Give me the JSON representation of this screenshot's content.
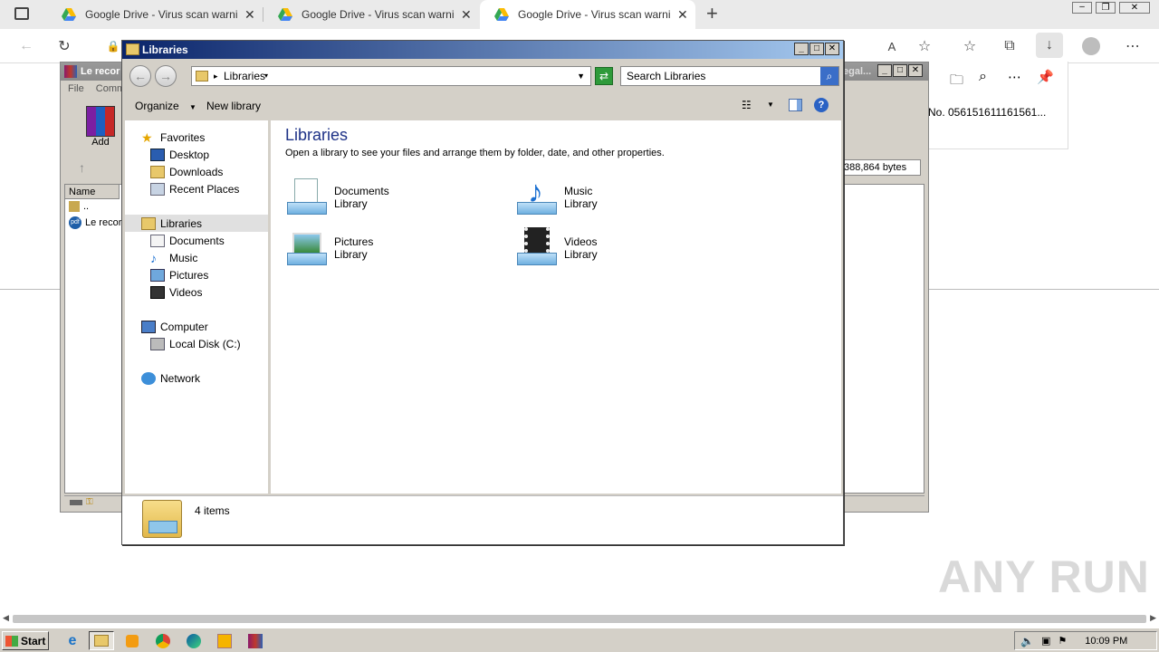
{
  "browser": {
    "tabs": [
      {
        "title": "Google Drive - Virus scan warning"
      },
      {
        "title": "Google Drive - Virus scan warning"
      },
      {
        "title": "Google Drive - Virus scan warning"
      }
    ],
    "new_tab": "+",
    "download_panel_text": "No. 056151611161561..."
  },
  "winrar": {
    "title": "Le recor",
    "title_right": "egal...",
    "menu": [
      "File",
      "Comm"
    ],
    "add_label": "Add",
    "column_name": "Name",
    "rows": [
      "..",
      "Le recor"
    ],
    "size_text": "388,864 bytes"
  },
  "explorer": {
    "title": "Libraries",
    "address": "Libraries",
    "search_placeholder": "Search Libraries",
    "organize": "Organize",
    "new_library": "New library",
    "nav": {
      "favorites": "Favorites",
      "desktop": "Desktop",
      "downloads": "Downloads",
      "recent": "Recent Places",
      "libraries": "Libraries",
      "documents": "Documents",
      "music": "Music",
      "pictures": "Pictures",
      "videos": "Videos",
      "computer": "Computer",
      "local_disk": "Local Disk (C:)",
      "network": "Network"
    },
    "heading": "Libraries",
    "subheading": "Open a library to see your files and arrange them by folder, date, and other properties.",
    "libraries": [
      {
        "name": "Documents",
        "type": "Library"
      },
      {
        "name": "Music",
        "type": "Library"
      },
      {
        "name": "Pictures",
        "type": "Library"
      },
      {
        "name": "Videos",
        "type": "Library"
      }
    ],
    "status": "4 items"
  },
  "taskbar": {
    "start": "Start",
    "clock": "10:09 PM"
  },
  "watermark": "ANY RUN"
}
